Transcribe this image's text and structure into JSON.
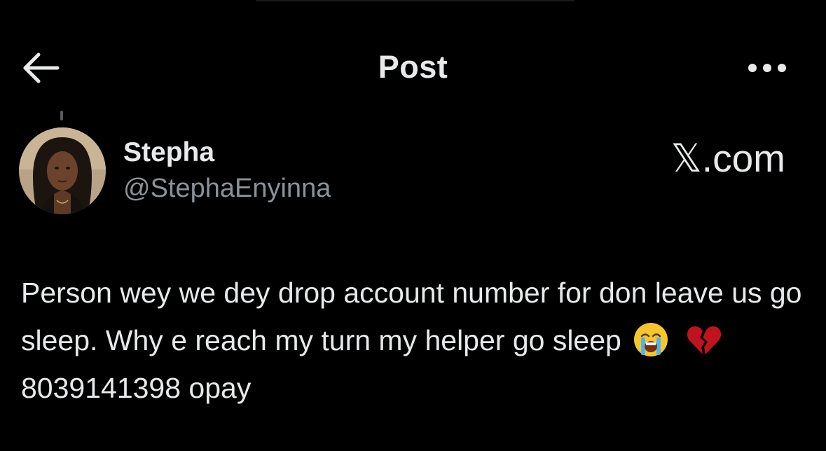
{
  "header": {
    "back_icon": "arrow-left-icon",
    "title": "Post",
    "more_icon": "more-horizontal-icon"
  },
  "author": {
    "display_name": "Stepha",
    "handle": "@StephaEnyinna"
  },
  "watermark": {
    "text": "𝕏.com"
  },
  "post": {
    "text_line_part1": "Person wey we dey drop account number for don leave us go sleep. Why e reach my turn my helper go sleep",
    "emojis": [
      "loudly-crying-face-icon",
      "broken-heart-icon"
    ],
    "text_line_part2": "8039141398 opay"
  },
  "colors": {
    "background": "#000000",
    "primary_text": "#e7e9ea",
    "secondary_text": "#8b9299"
  }
}
